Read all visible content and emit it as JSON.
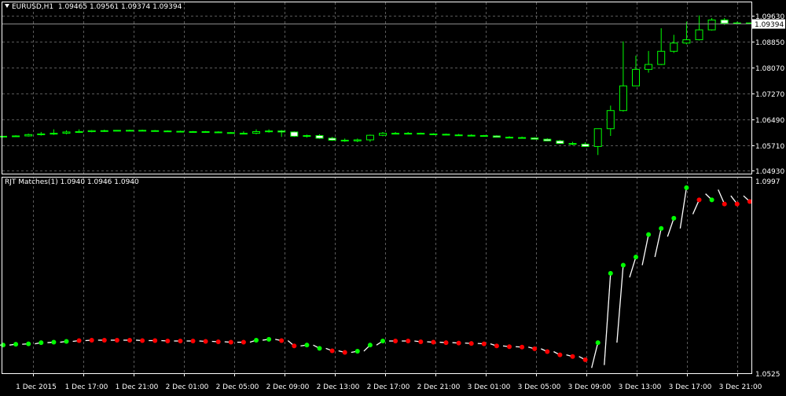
{
  "main_chart": {
    "symbol": "EURUSD,H1",
    "ohlc": "1.09465 1.09561 1.09374 1.09394",
    "price_labels": [
      "1.09630",
      "1.08850",
      "1.08070",
      "1.07270",
      "1.06490",
      "1.05710",
      "1.04930"
    ],
    "current_price": "1.09394"
  },
  "indicator": {
    "title": "RJT Matches(1) 1.0940 1.0946 1.0940",
    "scale_high": "1.0997",
    "scale_low": "1.0525"
  },
  "time_axis": {
    "labels": [
      "1 Dec 2015",
      "1 Dec 17:00",
      "1 Dec 21:00",
      "2 Dec 01:00",
      "2 Dec 05:00",
      "2 Dec 09:00",
      "2 Dec 13:00",
      "2 Dec 17:00",
      "2 Dec 21:00",
      "3 Dec 01:00",
      "3 Dec 05:00",
      "3 Dec 09:00",
      "3 Dec 13:00",
      "3 Dec 17:00",
      "3 Dec 21:00"
    ]
  },
  "colors": {
    "background": "#000000",
    "bull_candle": "#000000",
    "bear_candle": "#ffffff",
    "wick": "#00ff00",
    "grid": "#5a5a5a",
    "up_dot": "#00ff00",
    "down_dot": "#ff0000"
  },
  "chart_data": [
    {
      "type": "candlestick",
      "title": "EURUSD,H1",
      "ylim": [
        1.0485,
        1.0975
      ],
      "x": [
        "1 Dec 13:00",
        "1 Dec 14:00",
        "1 Dec 15:00",
        "1 Dec 16:00",
        "1 Dec 17:00",
        "1 Dec 18:00",
        "1 Dec 19:00",
        "1 Dec 20:00",
        "1 Dec 21:00",
        "1 Dec 22:00",
        "1 Dec 23:00",
        "2 Dec 00:00",
        "2 Dec 01:00",
        "2 Dec 02:00",
        "2 Dec 03:00",
        "2 Dec 04:00",
        "2 Dec 05:00",
        "2 Dec 06:00",
        "2 Dec 07:00",
        "2 Dec 08:00",
        "2 Dec 09:00",
        "2 Dec 10:00",
        "2 Dec 11:00",
        "2 Dec 12:00",
        "2 Dec 13:00",
        "2 Dec 14:00",
        "2 Dec 15:00",
        "2 Dec 16:00",
        "2 Dec 17:00",
        "2 Dec 18:00",
        "2 Dec 19:00",
        "2 Dec 20:00",
        "2 Dec 21:00",
        "2 Dec 22:00",
        "2 Dec 23:00",
        "3 Dec 00:00",
        "3 Dec 01:00",
        "3 Dec 02:00",
        "3 Dec 03:00",
        "3 Dec 04:00",
        "3 Dec 05:00",
        "3 Dec 06:00",
        "3 Dec 07:00",
        "3 Dec 08:00",
        "3 Dec 09:00",
        "3 Dec 10:00",
        "3 Dec 11:00",
        "3 Dec 12:00",
        "3 Dec 13:00",
        "3 Dec 14:00",
        "3 Dec 15:00",
        "3 Dec 16:00",
        "3 Dec 17:00",
        "3 Dec 18:00",
        "3 Dec 19:00",
        "3 Dec 20:00",
        "3 Dec 21:00",
        "3 Dec 22:00",
        "3 Dec 23:00",
        "4 Dec 00:00"
      ],
      "open": [
        1.0595,
        1.0597,
        1.0598,
        1.0602,
        1.0604,
        1.0606,
        1.061,
        1.0611,
        1.0614,
        1.0614,
        1.0615,
        1.0615,
        1.0614,
        1.0613,
        1.0612,
        1.0611,
        1.0611,
        1.061,
        1.0608,
        1.0606,
        1.0606,
        1.0611,
        1.0613,
        1.061,
        1.0597,
        1.0599,
        1.0591,
        1.0585,
        1.0583,
        1.0586,
        1.06,
        1.0606,
        1.0606,
        1.0606,
        1.0604,
        1.0603,
        1.0601,
        1.06,
        1.0599,
        1.0598,
        1.0594,
        1.0593,
        1.0592,
        1.0588,
        1.0583,
        1.0575,
        1.0573,
        1.0566,
        1.062,
        1.0675,
        1.075,
        1.08,
        1.0815,
        1.0855,
        1.088,
        1.089,
        1.092,
        1.095,
        1.094,
        1.0941
      ],
      "high": [
        1.0598,
        1.06,
        1.0605,
        1.061,
        1.0618,
        1.0615,
        1.0618,
        1.0616,
        1.0617,
        1.0616,
        1.0617,
        1.0617,
        1.0616,
        1.0615,
        1.0614,
        1.0613,
        1.0613,
        1.0612,
        1.061,
        1.0612,
        1.0618,
        1.0618,
        1.0616,
        1.0612,
        1.0602,
        1.0603,
        1.0595,
        1.059,
        1.059,
        1.0602,
        1.061,
        1.061,
        1.061,
        1.0608,
        1.0606,
        1.0605,
        1.0604,
        1.0603,
        1.0601,
        1.06,
        1.0597,
        1.0596,
        1.0594,
        1.0591,
        1.0586,
        1.058,
        1.0579,
        1.062,
        1.069,
        1.0885,
        1.0842,
        1.0856,
        1.0925,
        1.0905,
        1.0945,
        1.0964,
        1.0956,
        1.0956,
        1.0945,
        1.0942
      ],
      "low": [
        1.0593,
        1.0595,
        1.0596,
        1.0599,
        1.0601,
        1.0603,
        1.0607,
        1.0609,
        1.061,
        1.0612,
        1.0613,
        1.0613,
        1.0612,
        1.0611,
        1.061,
        1.0609,
        1.0609,
        1.0607,
        1.0605,
        1.0603,
        1.0603,
        1.0608,
        1.0595,
        1.0595,
        1.0593,
        1.0589,
        1.0583,
        1.058,
        1.0579,
        1.058,
        1.0597,
        1.0603,
        1.0603,
        1.0603,
        1.0601,
        1.06,
        1.0598,
        1.0597,
        1.0596,
        1.0595,
        1.0592,
        1.059,
        1.0589,
        1.0582,
        1.0576,
        1.057,
        1.0565,
        1.054,
        1.0598,
        1.0672,
        1.079,
        1.079,
        1.0813,
        1.085,
        1.0876,
        1.0888,
        1.0918,
        1.0935,
        1.0936,
        1.0938
      ],
      "close": [
        1.0597,
        1.0598,
        1.0602,
        1.0604,
        1.0606,
        1.061,
        1.0611,
        1.0614,
        1.0614,
        1.0615,
        1.0615,
        1.0614,
        1.0613,
        1.0612,
        1.0611,
        1.0611,
        1.061,
        1.0608,
        1.0606,
        1.0606,
        1.0611,
        1.0613,
        1.061,
        1.0597,
        1.0599,
        1.0591,
        1.0585,
        1.0583,
        1.0586,
        1.06,
        1.0606,
        1.0606,
        1.0606,
        1.0604,
        1.0603,
        1.0601,
        1.06,
        1.0599,
        1.0598,
        1.0594,
        1.0593,
        1.0592,
        1.0588,
        1.0583,
        1.0575,
        1.0573,
        1.0566,
        1.062,
        1.0675,
        1.075,
        1.08,
        1.0815,
        1.0855,
        1.088,
        1.089,
        1.092,
        1.095,
        1.094,
        1.0941,
        1.0939
      ]
    },
    {
      "type": "scatter",
      "title": "RJT Matches(1) 1.0940 1.0946 1.0940",
      "ylim": [
        1.0525,
        1.0997
      ],
      "x": [
        "1 Dec 13:00",
        "1 Dec 14:00",
        "1 Dec 15:00",
        "1 Dec 16:00",
        "1 Dec 17:00",
        "1 Dec 18:00",
        "1 Dec 19:00",
        "1 Dec 20:00",
        "1 Dec 21:00",
        "1 Dec 22:00",
        "1 Dec 23:00",
        "2 Dec 00:00",
        "2 Dec 01:00",
        "2 Dec 02:00",
        "2 Dec 03:00",
        "2 Dec 04:00",
        "2 Dec 05:00",
        "2 Dec 06:00",
        "2 Dec 07:00",
        "2 Dec 08:00",
        "2 Dec 09:00",
        "2 Dec 10:00",
        "2 Dec 11:00",
        "2 Dec 12:00",
        "2 Dec 13:00",
        "2 Dec 14:00",
        "2 Dec 15:00",
        "2 Dec 16:00",
        "2 Dec 17:00",
        "2 Dec 18:00",
        "2 Dec 19:00",
        "2 Dec 20:00",
        "2 Dec 21:00",
        "2 Dec 22:00",
        "2 Dec 23:00",
        "3 Dec 00:00",
        "3 Dec 01:00",
        "3 Dec 02:00",
        "3 Dec 03:00",
        "3 Dec 04:00",
        "3 Dec 05:00",
        "3 Dec 06:00",
        "3 Dec 07:00",
        "3 Dec 08:00",
        "3 Dec 09:00",
        "3 Dec 10:00",
        "3 Dec 11:00",
        "3 Dec 12:00",
        "3 Dec 13:00",
        "3 Dec 14:00",
        "3 Dec 15:00",
        "3 Dec 16:00",
        "3 Dec 17:00",
        "3 Dec 18:00",
        "3 Dec 19:00",
        "3 Dec 20:00",
        "3 Dec 21:00",
        "3 Dec 22:00",
        "3 Dec 23:00",
        "4 Dec 00:00"
      ],
      "open": [
        1.0594,
        1.0594,
        1.0596,
        1.0597,
        1.06,
        1.0601,
        1.0603,
        1.0605,
        1.0606,
        1.0606,
        1.0606,
        1.0606,
        1.0605,
        1.0605,
        1.0604,
        1.0604,
        1.0604,
        1.0603,
        1.0602,
        1.0601,
        1.0601,
        1.0606,
        1.0608,
        1.0605,
        1.0592,
        1.0594,
        1.0586,
        1.058,
        1.0576,
        1.0579,
        1.0594,
        1.0604,
        1.0604,
        1.0604,
        1.0602,
        1.0601,
        1.06,
        1.0599,
        1.0598,
        1.0597,
        1.0592,
        1.059,
        1.0589,
        1.0585,
        1.0578,
        1.057,
        1.0566,
        1.0538,
        1.0545,
        1.06,
        1.076,
        1.079,
        1.081,
        1.086,
        1.088,
        1.0915,
        1.0965,
        1.0975,
        1.096,
        1.096
      ],
      "close": [
        1.0594,
        1.0596,
        1.0597,
        1.06,
        1.0601,
        1.0603,
        1.0605,
        1.0606,
        1.0606,
        1.0606,
        1.0606,
        1.0605,
        1.0605,
        1.0604,
        1.0604,
        1.0604,
        1.0603,
        1.0602,
        1.0601,
        1.0601,
        1.0606,
        1.0608,
        1.0605,
        1.0592,
        1.0594,
        1.0586,
        1.058,
        1.0576,
        1.0579,
        1.0594,
        1.0604,
        1.0604,
        1.0604,
        1.0602,
        1.0601,
        1.06,
        1.0599,
        1.0598,
        1.0597,
        1.0592,
        1.059,
        1.0589,
        1.0585,
        1.0578,
        1.057,
        1.0566,
        1.0558,
        1.06,
        1.077,
        1.079,
        1.081,
        1.0865,
        1.088,
        1.0905,
        1.098,
        1.095,
        1.095,
        1.094,
        1.094,
        1.0946
      ],
      "direction": [
        "up",
        "up",
        "up",
        "up",
        "up",
        "up",
        "down",
        "down",
        "down",
        "down",
        "down",
        "down",
        "down",
        "down",
        "down",
        "down",
        "down",
        "down",
        "down",
        "down",
        "up",
        "up",
        "down",
        "down",
        "up",
        "up",
        "down",
        "down",
        "up",
        "up",
        "up",
        "down",
        "down",
        "down",
        "down",
        "down",
        "down",
        "down",
        "down",
        "down",
        "down",
        "down",
        "down",
        "down",
        "down",
        "down",
        "down",
        "up",
        "up",
        "up",
        "up",
        "up",
        "up",
        "up",
        "up",
        "down",
        "up",
        "down",
        "down",
        "down"
      ]
    }
  ]
}
